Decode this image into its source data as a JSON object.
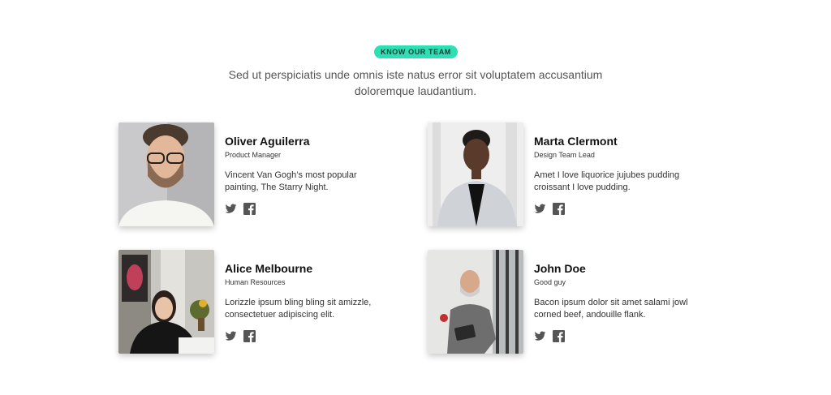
{
  "badge": "KNOW OUR TEAM",
  "intro": "Sed ut perspiciatis unde omnis iste natus error sit voluptatem accusantium doloremque laudantium.",
  "members": [
    {
      "name": "Oliver Aguilerra",
      "role": "Product Manager",
      "bio": "Vincent Van Gogh’s most popular painting, The Starry Night."
    },
    {
      "name": "Marta Clermont",
      "role": "Design Team Lead",
      "bio": "Amet I love liquorice jujubes pudding croissant I love pudding."
    },
    {
      "name": "Alice Melbourne",
      "role": "Human Resources",
      "bio": "Lorizzle ipsum bling bling sit amizzle, consectetuer adipiscing elit."
    },
    {
      "name": "John Doe",
      "role": "Good guy",
      "bio": "Bacon ipsum dolor sit amet salami jowl corned beef, andouille flank."
    }
  ],
  "icons": {
    "twitter": "twitter-icon",
    "facebook": "facebook-icon"
  },
  "colors": {
    "badge": "#2de0b4",
    "icon": "#555555"
  }
}
